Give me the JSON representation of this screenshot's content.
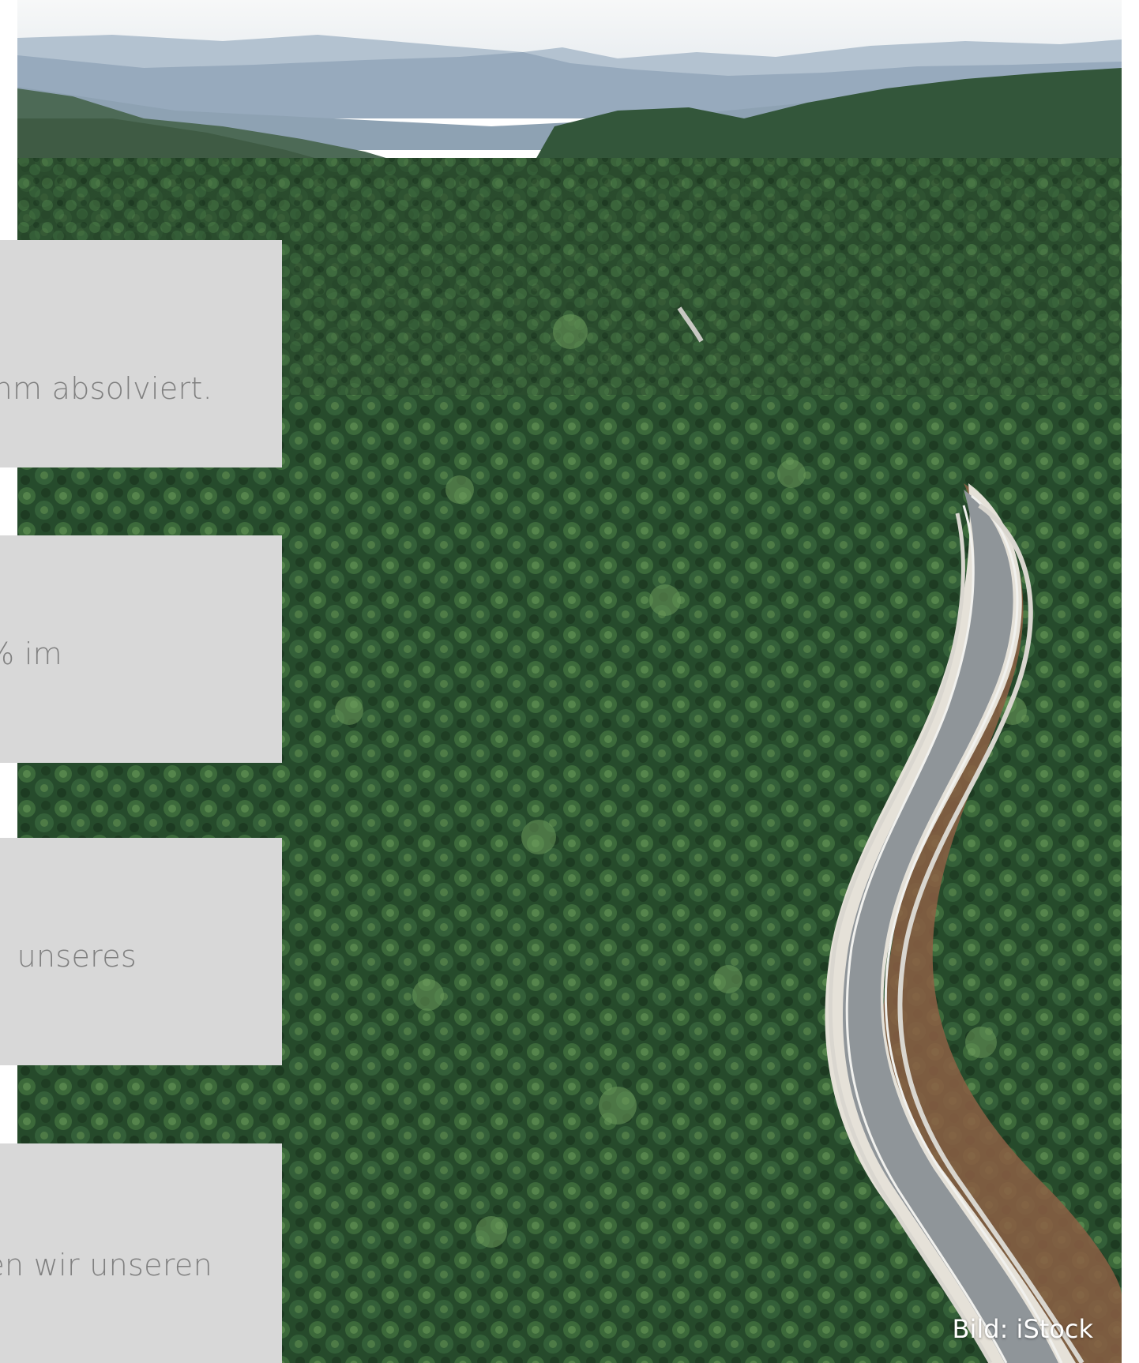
{
  "photo": {
    "subject": "aerial-forest-road",
    "colors": {
      "sky": "#f4f6f7",
      "mountains_far": "#a9b9c8",
      "mountains_near": "#7f93a8",
      "forest_dark": "#1f3a22",
      "forest_mid": "#2f5a31",
      "forest_light": "#4f7c45",
      "road": "#8f9498",
      "road_edge": "#e9e6e0",
      "soil": "#8a5a3e"
    }
  },
  "panels": [
    {
      "text": "nm absolviert."
    },
    {
      "text": "% im"
    },
    {
      "text": "unseres"
    },
    {
      "text": "en wir unseren"
    }
  ],
  "credit": "Bild: iStock",
  "colors": {
    "panel_bg": "#d8d8d8",
    "panel_text": "#808080",
    "credit_text": "#ffffff"
  }
}
